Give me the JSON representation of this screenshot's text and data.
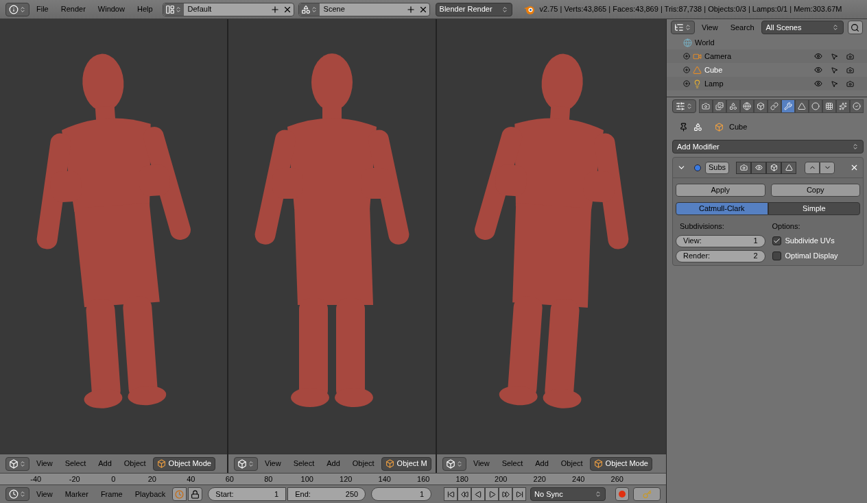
{
  "top_bar": {
    "menus": [
      "File",
      "Render",
      "Window",
      "Help"
    ],
    "layout": "Default",
    "scene": "Scene",
    "engine": "Blender Render",
    "stats": "v2.75 | Verts:43,865 | Faces:43,869 | Tris:87,738 | Objects:0/3 | Lamps:0/1 | Mem:303.67M"
  },
  "viewports": [
    {
      "menus": [
        "View",
        "Select",
        "Add",
        "Object"
      ],
      "mode": "Object Mode"
    },
    {
      "menus": [
        "View",
        "Select",
        "Add",
        "Object"
      ],
      "mode": "Object M"
    },
    {
      "menus": [
        "View",
        "Select",
        "Add",
        "Object"
      ],
      "mode": "Object Mode"
    }
  ],
  "timeline": {
    "ruler": [
      "-40",
      "-20",
      "0",
      "20",
      "40",
      "60",
      "80",
      "100",
      "120",
      "140",
      "160",
      "180",
      "200",
      "220",
      "240",
      "260"
    ],
    "menus": [
      "View",
      "Marker",
      "Frame",
      "Playback"
    ],
    "start_label": "Start:",
    "start": "1",
    "end_label": "End:",
    "end": "250",
    "current": "1",
    "sync": "No Sync"
  },
  "outliner": {
    "menus": [
      "View",
      "Search"
    ],
    "filter": "All Scenes",
    "items": [
      {
        "name": "World",
        "kind": "world"
      },
      {
        "name": "Camera",
        "kind": "camera"
      },
      {
        "name": "Cube",
        "kind": "mesh"
      },
      {
        "name": "Lamp",
        "kind": "lamp"
      }
    ]
  },
  "properties": {
    "tabs": [
      {
        "kind": "render",
        "selected": false
      },
      {
        "kind": "layers",
        "selected": false
      },
      {
        "kind": "scene",
        "selected": false
      },
      {
        "kind": "world",
        "selected": false
      },
      {
        "kind": "object",
        "selected": false
      },
      {
        "kind": "constraints",
        "selected": false
      },
      {
        "kind": "modifiers",
        "selected": true
      },
      {
        "kind": "data",
        "selected": false
      },
      {
        "kind": "material",
        "selected": false
      },
      {
        "kind": "texture",
        "selected": false
      },
      {
        "kind": "particles",
        "selected": false
      },
      {
        "kind": "physics",
        "selected": false
      }
    ],
    "breadcrumb": "Cube",
    "add_modifier": "Add Modifier",
    "modifier": {
      "name": "Subs",
      "apply": "Apply",
      "copy": "Copy",
      "types": [
        {
          "label": "Catmull-Clark",
          "selected": true
        },
        {
          "label": "Simple",
          "selected": false
        }
      ],
      "subdivisions_label": "Subdivisions:",
      "view_label": "View:",
      "view": "1",
      "render_label": "Render:",
      "render": "2",
      "options_label": "Options:",
      "options": [
        {
          "label": "Subdivide UVs",
          "checked": true
        },
        {
          "label": "Optimal Display",
          "checked": false
        }
      ]
    }
  }
}
